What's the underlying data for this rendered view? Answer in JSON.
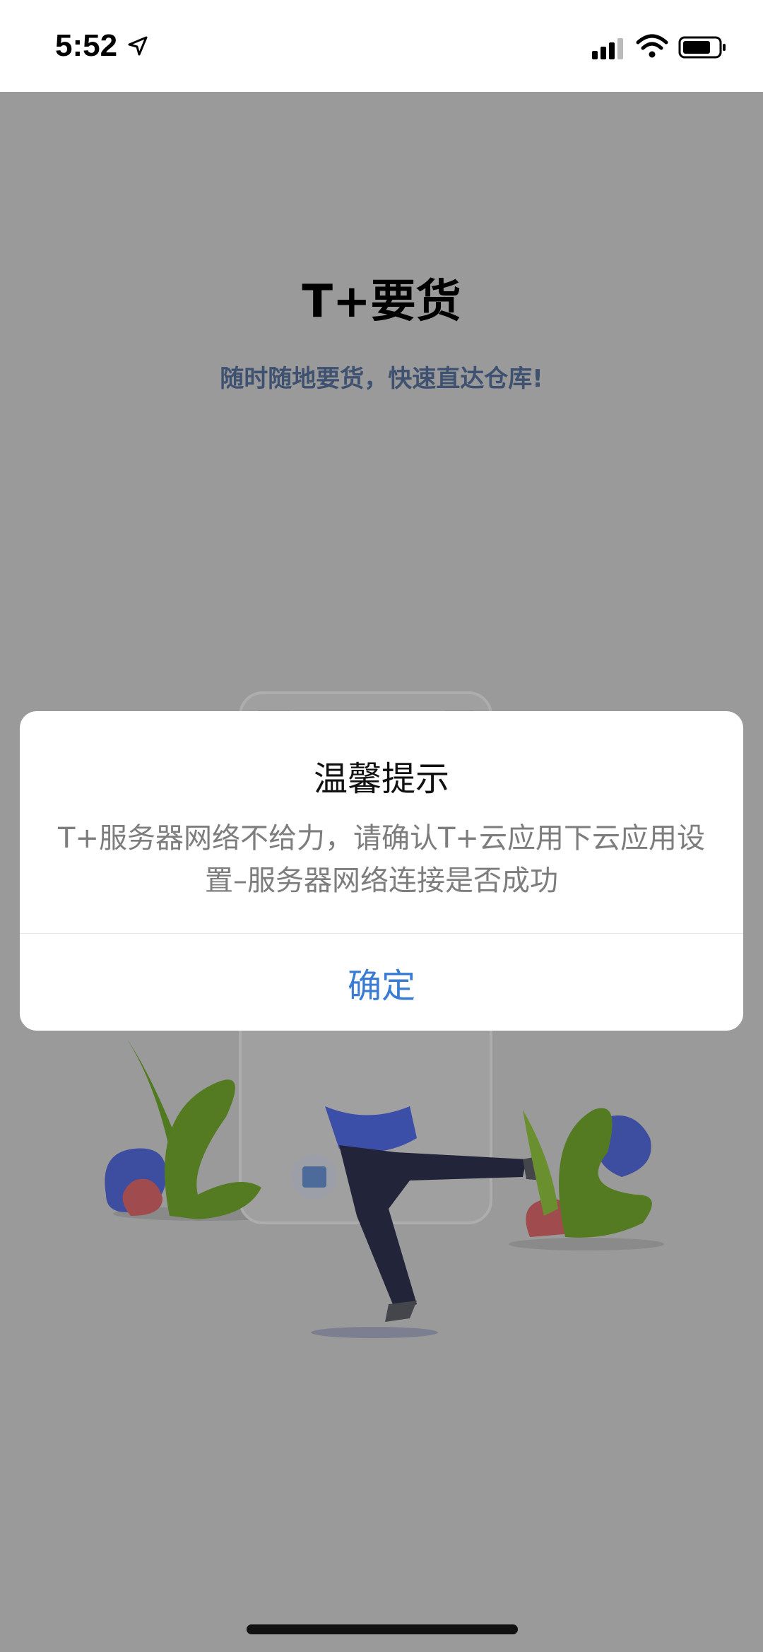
{
  "status_bar": {
    "time": "5:52",
    "icons": [
      "location-arrow-icon",
      "cellular-signal-icon",
      "wifi-icon",
      "battery-icon"
    ]
  },
  "page": {
    "title": "T+要货",
    "subtitle": "随时随地要货，快速直达仓库!"
  },
  "dialog": {
    "title": "温馨提示",
    "message": "T+服务器网络不给力，请确认T+云应用下云应用设置–服务器网络连接是否成功",
    "confirm_label": "确定"
  },
  "colors": {
    "overlay": "#9a9a9a",
    "accent": "#3a7bd5",
    "subtitle": "#3f5170"
  }
}
